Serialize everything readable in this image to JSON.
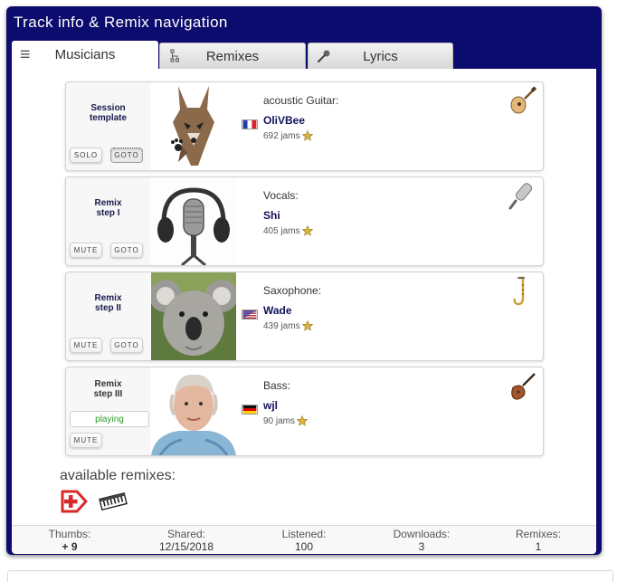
{
  "window": {
    "title": "Track info & Remix navigation"
  },
  "tabs": [
    {
      "label": "Musicians",
      "icon": "menu-icon",
      "active": true
    },
    {
      "label": "Remixes",
      "icon": "hierarchy-icon",
      "active": false
    },
    {
      "label": "Lyrics",
      "icon": "microphone-icon",
      "active": false
    }
  ],
  "tracks": [
    {
      "step": "Session template",
      "buttons": [
        "SOLO",
        "GOTO"
      ],
      "instrument": "acoustic Guitar:",
      "musician": "OliVBee",
      "jams": "692 jams",
      "flag": "france",
      "instrument_icon": "acoustic-guitar-icon",
      "photo": "wolf-avatar"
    },
    {
      "step": "Remix step I",
      "buttons": [
        "MUTE",
        "GOTO"
      ],
      "instrument": "Vocals:",
      "musician": "Shi",
      "jams": "405 jams",
      "flag": "",
      "instrument_icon": "microphone-icon",
      "photo": "studio-microphone-headphones"
    },
    {
      "step": "Remix step II",
      "buttons": [
        "MUTE",
        "GOTO"
      ],
      "instrument": "Saxophone:",
      "musician": "Wade",
      "jams": "439 jams",
      "flag": "usa",
      "instrument_icon": "saxophone-icon",
      "photo": "koala-avatar"
    },
    {
      "step": "Remix step III",
      "status": "playing",
      "buttons": [
        "MUTE"
      ],
      "instrument": "Bass:",
      "musician": "wjl",
      "jams": "90 jams",
      "flag": "germany",
      "instrument_icon": "bass-guitar-icon",
      "photo": "man-portrait"
    }
  ],
  "available_remixes": {
    "label": "available remixes:",
    "items": [
      {
        "icon": "add-remix-icon"
      },
      {
        "icon": "keyboard-icon"
      }
    ]
  },
  "stats": [
    {
      "label": "Thumbs:",
      "value": "+ 9"
    },
    {
      "label": "Shared:",
      "value": "12/15/2018"
    },
    {
      "label": "Listened:",
      "value": "100"
    },
    {
      "label": "Downloads:",
      "value": "3"
    },
    {
      "label": "Remixes:",
      "value": "1"
    }
  ],
  "colors": {
    "window_bg": "#0c0c6e",
    "accent_link": "#11115a",
    "playing": "#2a9a2a"
  }
}
